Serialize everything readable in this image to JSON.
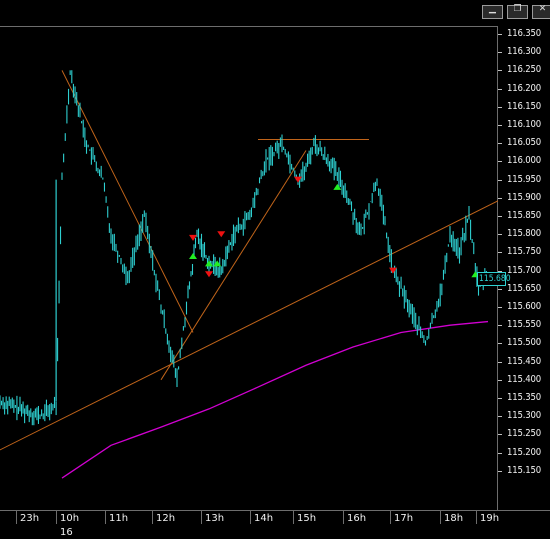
{
  "window": {
    "buttons": [
      {
        "name": "minimize-button",
        "glyph": "▁"
      },
      {
        "name": "restore-button",
        "glyph": "❐"
      },
      {
        "name": "close-button",
        "glyph": "✕"
      }
    ]
  },
  "price_axis": {
    "labels": [
      "116.350",
      "116.300",
      "116.250",
      "116.200",
      "116.150",
      "116.100",
      "116.050",
      "116.000",
      "115.950",
      "115.900",
      "115.850",
      "115.800",
      "115.750",
      "115.700",
      "115.650",
      "115.600",
      "115.550",
      "115.500",
      "115.450",
      "115.400",
      "115.350",
      "115.300",
      "115.250",
      "115.200",
      "115.150"
    ],
    "current_price": "115.680"
  },
  "time_axis": {
    "labels": [
      "23h",
      "10h",
      "11h",
      "12h",
      "13h",
      "14h",
      "15h",
      "16h",
      "17h",
      "18h",
      "19h"
    ],
    "date": "16"
  },
  "colors": {
    "price_line": "#2ecfd0",
    "moving_average": "#d100d1",
    "trendline": "#c0641a",
    "buy_arrow": "#22ee22",
    "sell_arrow": "#ee1111"
  },
  "chart_data": {
    "type": "line",
    "title": "",
    "xlabel": "",
    "ylabel": "",
    "ylim": [
      115.12,
      116.37
    ],
    "x_ticks": [
      "23h",
      "10h",
      "11h",
      "12h",
      "13h",
      "14h",
      "15h",
      "16h",
      "17h",
      "18h",
      "19h"
    ],
    "series": [
      {
        "x": [
          "22:30",
          "23:00",
          "23:30",
          "09:50",
          "10:00",
          "10:10",
          "10:30",
          "10:50",
          "11:00",
          "11:20",
          "11:40",
          "12:00",
          "12:20",
          "12:30",
          "12:45",
          "13:00",
          "13:15",
          "13:30",
          "13:50",
          "14:10",
          "14:30",
          "14:50",
          "15:00",
          "15:10",
          "15:30",
          "15:50",
          "16:10",
          "16:30",
          "16:50",
          "17:10",
          "17:30",
          "17:50",
          "18:00",
          "18:15",
          "18:30",
          "18:45",
          "19:00"
        ],
        "values": [
          115.34,
          115.32,
          115.3,
          115.33,
          115.95,
          116.25,
          116.05,
          115.95,
          115.8,
          115.68,
          115.85,
          115.6,
          115.4,
          115.57,
          115.8,
          115.72,
          115.7,
          115.8,
          115.85,
          116.0,
          116.05,
          115.95,
          115.98,
          116.05,
          116.0,
          115.92,
          115.8,
          115.95,
          115.7,
          115.6,
          115.5,
          115.65,
          115.8,
          115.75,
          115.85,
          115.65,
          115.7
        ]
      },
      {
        "x": [
          "10:00",
          "11:00",
          "12:00",
          "13:00",
          "14:00",
          "15:00",
          "16:00",
          "17:00",
          "18:00",
          "19:00"
        ],
        "values": [
          115.13,
          115.22,
          115.27,
          115.32,
          115.38,
          115.44,
          115.49,
          115.53,
          115.55,
          115.56
        ]
      }
    ],
    "trendlines": [
      {
        "from": [
          "10:00",
          116.25
        ],
        "to": [
          "12:40",
          115.53
        ]
      },
      {
        "from": [
          "12:00",
          115.4
        ],
        "to": [
          "15:00",
          116.03
        ]
      },
      {
        "from": [
          "22:00",
          115.18
        ],
        "to": [
          "19:20",
          115.9
        ]
      },
      {
        "from": [
          "14:00",
          116.06
        ],
        "to": [
          "16:20",
          116.06
        ]
      }
    ],
    "signals": {
      "buy": [
        [
          "12:40",
          115.74
        ],
        [
          "13:00",
          115.72
        ],
        [
          "13:10",
          115.72
        ],
        [
          "15:40",
          115.93
        ],
        [
          "18:40",
          115.69
        ]
      ],
      "sell": [
        [
          "12:40",
          115.79
        ],
        [
          "13:00",
          115.69
        ],
        [
          "13:15",
          115.8
        ],
        [
          "14:50",
          115.95
        ],
        [
          "16:50",
          115.7
        ]
      ]
    }
  }
}
